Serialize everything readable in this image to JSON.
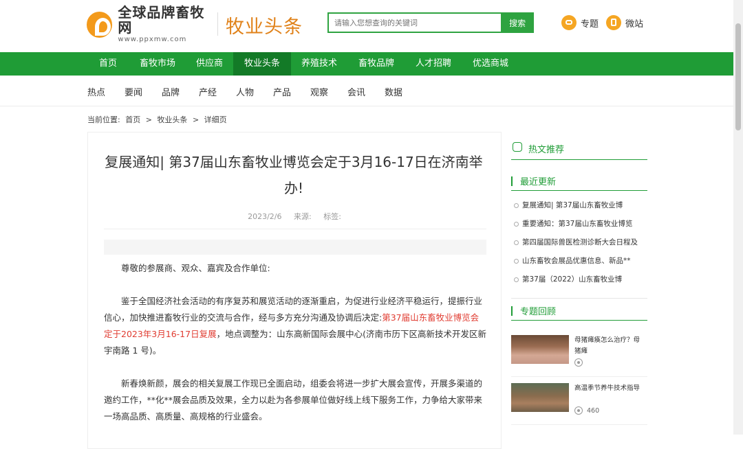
{
  "header": {
    "logo_cn": "全球品牌畜牧网",
    "logo_url": "www.ppxmw.com",
    "section_title": "牧业头条",
    "search_placeholder": "请输入您想查询的关键词",
    "search_button": "搜索",
    "quick_links": [
      {
        "label": "专题",
        "icon": "topic-icon"
      },
      {
        "label": "微站",
        "icon": "weizhan-icon"
      }
    ]
  },
  "nav": {
    "items": [
      "首页",
      "畜牧市场",
      "供应商",
      "牧业头条",
      "养殖技术",
      "畜牧品牌",
      "人才招聘",
      "优选商城"
    ],
    "active": "牧业头条"
  },
  "subnav": {
    "items": [
      "热点",
      "要闻",
      "品牌",
      "产经",
      "人物",
      "产品",
      "观察",
      "会讯",
      "数据"
    ]
  },
  "breadcrumb": {
    "prefix": "当前位置:",
    "items": [
      "首页",
      "牧业头条",
      "详细页"
    ],
    "sep": ">"
  },
  "article": {
    "title": "复展通知| 第37届山东畜牧业博览会定于3月16-17日在济南举办!",
    "date": "2023/2/6",
    "source_label": "来源:",
    "tags_label": "标签:",
    "greeting": "尊敬的参展商、观众、嘉宾及合作单位:",
    "p1_before": "鉴于全国经济社会活动的有序复苏和展览活动的逐渐重启，为促进行业经济平稳运行，提振行业信心，加快推进畜牧行业的交流与合作，经与多方充分沟通及协调后决定:",
    "p1_highlight": "第37届山东畜牧业博览会定于2023年3月16-17日复展",
    "p1_after": "，地点调整为：山东高新国际会展中心(济南市历下区高新技术开发区新宇南路 1 号)。",
    "p2": "新春焕新颜，展会的相关复展工作现已全面启动，组委会将进一步扩大展会宣传，开展多渠道的邀约工作，**化**展会品质及效果，全力以赴为各参展单位做好线上线下服务工作，力争给大家带来一场高品质、高质量、高规格的行业盛会。"
  },
  "sidebar": {
    "hot_title": "热文推荐",
    "latest_title": "最近更新",
    "latest_items": [
      "复展通知| 第37届山东畜牧业博",
      "重要通知：第37届山东畜牧业博览",
      "第四届国际兽医检测诊断大会日程及",
      "山东畜牧会展品优惠信息、新品**",
      "第37届（2022）山东畜牧业博"
    ],
    "topics_title": "专题回顾",
    "topics": [
      {
        "title": "母猪瘫痪怎么治疗？母猪瘫",
        "views": ""
      },
      {
        "title": "高温季节养牛技术指导",
        "views": "460"
      }
    ]
  },
  "colors": {
    "brand_green": "#1f9c36",
    "active_green": "#137a27",
    "accent_orange": "#e0821a",
    "highlight_red": "#e03c31"
  }
}
